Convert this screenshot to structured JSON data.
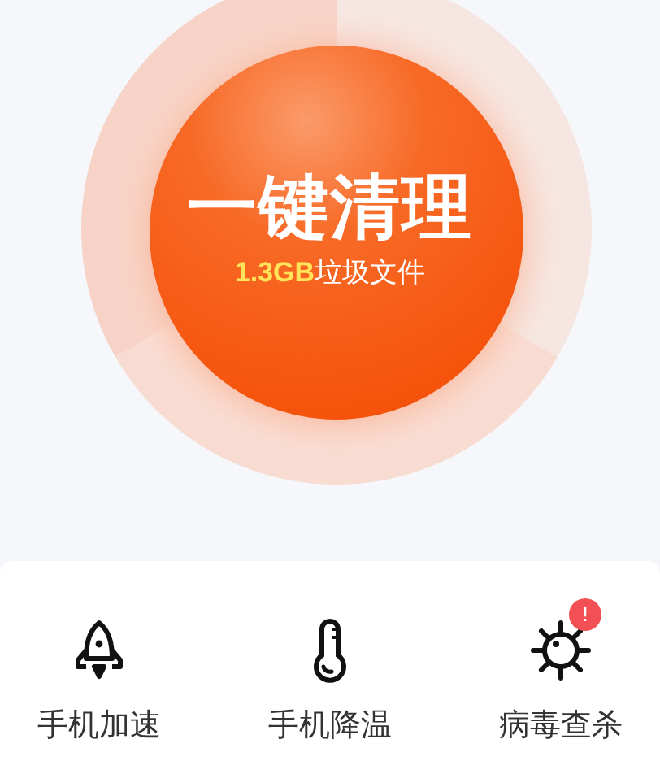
{
  "cleaner": {
    "title": "一键清理",
    "size": "1.3GB",
    "size_label": "垃圾文件"
  },
  "tools": [
    {
      "kind": "rocket",
      "label": "手机加速"
    },
    {
      "kind": "thermometer",
      "label": "手机降温"
    },
    {
      "kind": "virus",
      "label": "病毒查杀",
      "badge": "!"
    }
  ]
}
